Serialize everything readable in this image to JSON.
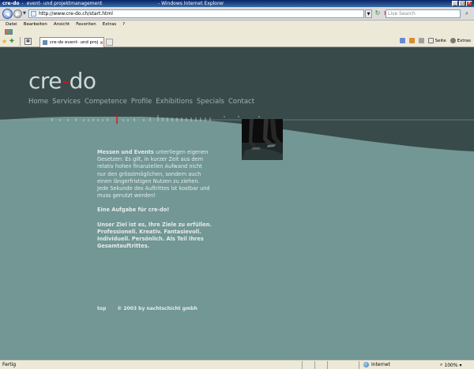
{
  "window": {
    "site_name": "cre-do",
    "separator": "-",
    "page_title": "event- und projektmanagement",
    "app_title": "- Windows Internet Explorer"
  },
  "address_bar": {
    "url": "http://www.cre-do.ch/start.html",
    "search_placeholder": "Live Search"
  },
  "menu": [
    "Datei",
    "Bearbeiten",
    "Ansicht",
    "Favoriten",
    "Extras",
    "?"
  ],
  "tab": {
    "label": "cre-do event- und proj..."
  },
  "tools": {
    "page_label": "Seite",
    "extras_label": "Extras"
  },
  "site": {
    "logo_left": "cre",
    "logo_dot": "-",
    "logo_right": "do",
    "nav": [
      "Home",
      "Services",
      "Competence",
      "Profile",
      "Exhibitions",
      "Specials",
      "Contact"
    ],
    "paragraphs": [
      {
        "lead": "Messen und Events",
        "text": " unterliegen eigenen Gesetzen: Es gilt, in kurzer Zeit aus dem relativ hohen finanziellen Aufwand nicht nur den grösstmöglichen, sondern auch einen längerfristigen Nutzen zu ziehen. Jede Sekunde des Auftrittes ist kostbar und muss genutzt werden!"
      },
      {
        "lead": "",
        "text": "Eine Aufgabe für cre-do!"
      },
      {
        "lead": "",
        "text": "Unser Ziel ist es, Ihre Ziele zu erfüllen. Professionell. Kreativ. Fantasievoll. Individuell. Persönlich. Als Teil Ihres Gesamtauftrittes."
      }
    ],
    "footer_top": "top",
    "copyright": "© 2003 by nachtschicht gmbh"
  },
  "status": {
    "text": "Fertig",
    "zone": "Internet",
    "zoom": "100%"
  },
  "colors": {
    "page_bg": "#729795",
    "header_bg": "#394a4a",
    "accent": "#c81818",
    "nav_text": "#9eb4b2"
  }
}
